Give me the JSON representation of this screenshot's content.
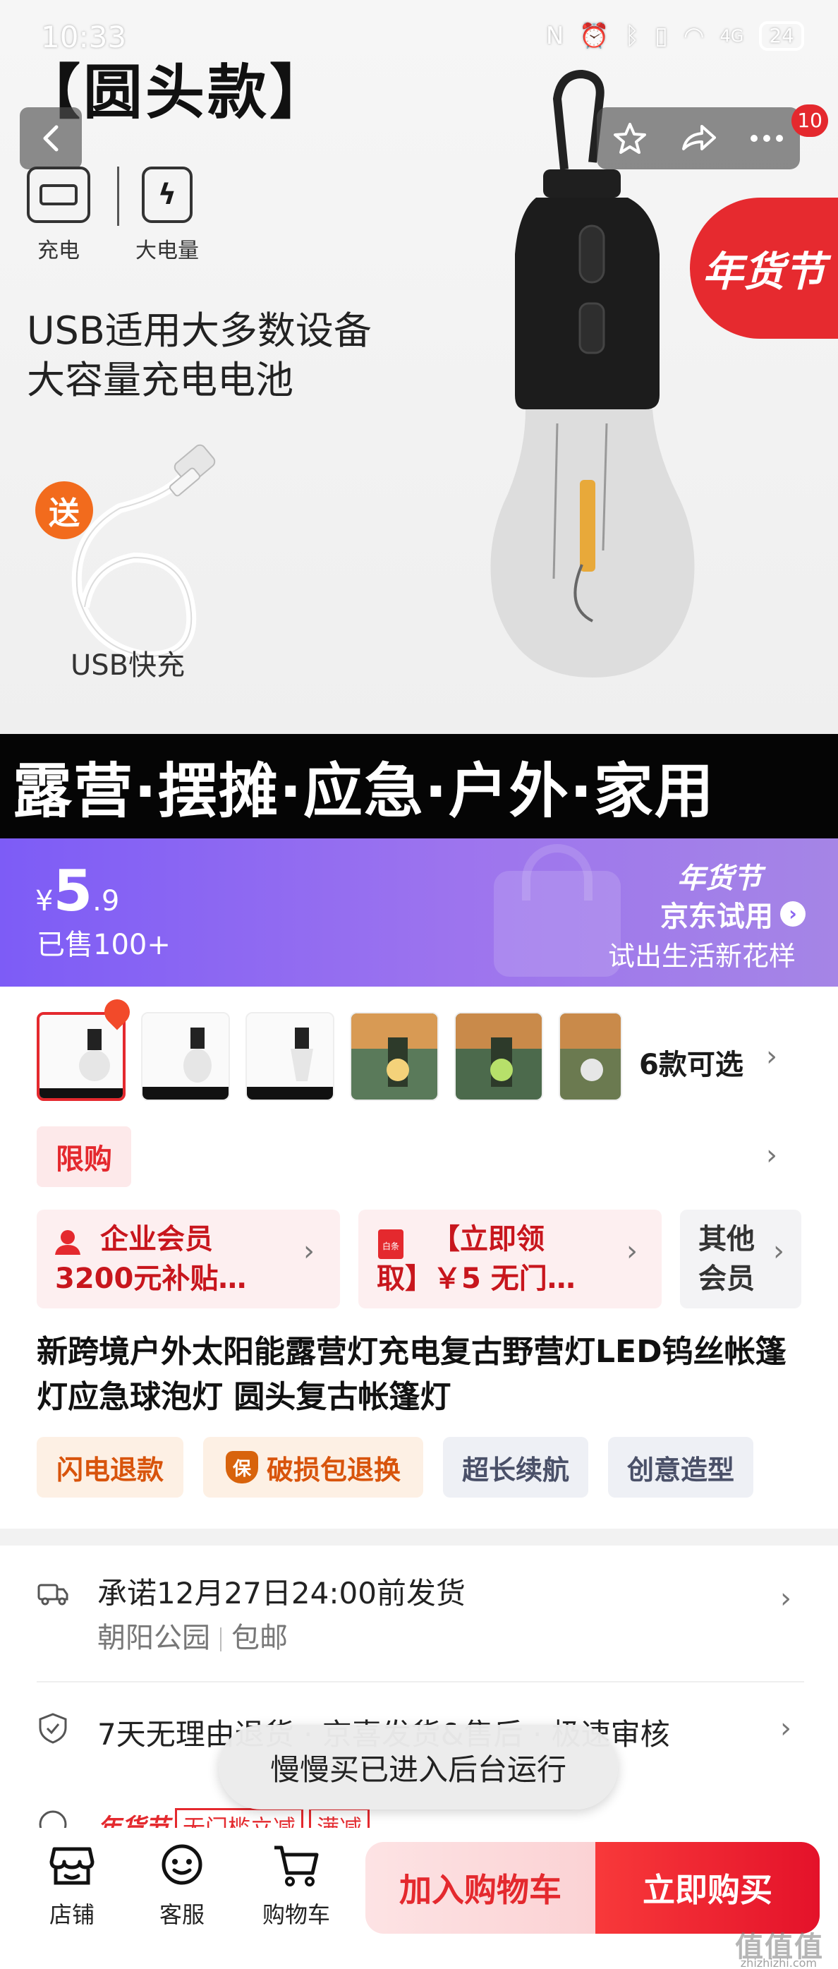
{
  "status_bar": {
    "time": "10:33",
    "battery": "24",
    "network": "4G"
  },
  "hero": {
    "title": "【圆头款】",
    "features": [
      {
        "label": "充电",
        "icon": "battery-charge-icon"
      },
      {
        "label": "大电量",
        "icon": "power-bank-icon"
      }
    ],
    "line1": "USB适用大多数设备",
    "line2": "大容量充电电池",
    "gift_badge": "送",
    "gift_label": "USB快充",
    "promo_badge": "年货节",
    "strip_text": "露营·摆摊·应急·户外·家用",
    "notification_count": "10"
  },
  "price_banner": {
    "currency": "¥",
    "price_int": "5",
    "price_dec": ".9",
    "sold": "已售100+",
    "trial_logo": "年货节",
    "trial_title": "京东试用",
    "trial_sub": "试出生活新花样"
  },
  "variants": {
    "more_label": "6款可选"
  },
  "limit_tag": "限购",
  "coupons": [
    {
      "line1": "企业会员",
      "line2": "3200元补贴…"
    },
    {
      "line1": "【立即领",
      "line2": "取】￥5 无门…"
    },
    {
      "line1": "其他",
      "line2": "会员"
    }
  ],
  "product": {
    "title": "新跨境户外太阳能露营灯充电复古野营灯LED钨丝帐篷灯应急球泡灯 圆头复古帐篷灯"
  },
  "tags": [
    {
      "label": "闪电退款",
      "style": "orange"
    },
    {
      "label": "破损包退换",
      "style": "orange",
      "icon": "保"
    },
    {
      "label": "超长续航",
      "style": "gray"
    },
    {
      "label": "创意造型",
      "style": "gray"
    }
  ],
  "shipping": {
    "promise": "承诺12月27日24:00前发货",
    "location": "朝阳公园",
    "postage": "包邮"
  },
  "returns": {
    "text": "7天无理由退货 · 京喜发货&售后 · 极速审核"
  },
  "partial_row": {
    "badge": "年货节",
    "box1": "无门槛立减",
    "box2": "满减"
  },
  "toast": "慢慢买已进入后台运行",
  "bottom_nav": [
    {
      "label": "店铺",
      "icon": "store-icon"
    },
    {
      "label": "客服",
      "icon": "customer-service-icon"
    },
    {
      "label": "购物车",
      "icon": "cart-icon"
    }
  ],
  "buttons": {
    "add_to_cart": "加入购物车",
    "buy_now": "立即购买"
  },
  "watermark": {
    "main": "值值值",
    "sub": "zhizhizhi.com"
  },
  "colors": {
    "accent_red": "#e4292e",
    "price_purple": "#8b66f0",
    "tag_orange": "#d8540c"
  }
}
